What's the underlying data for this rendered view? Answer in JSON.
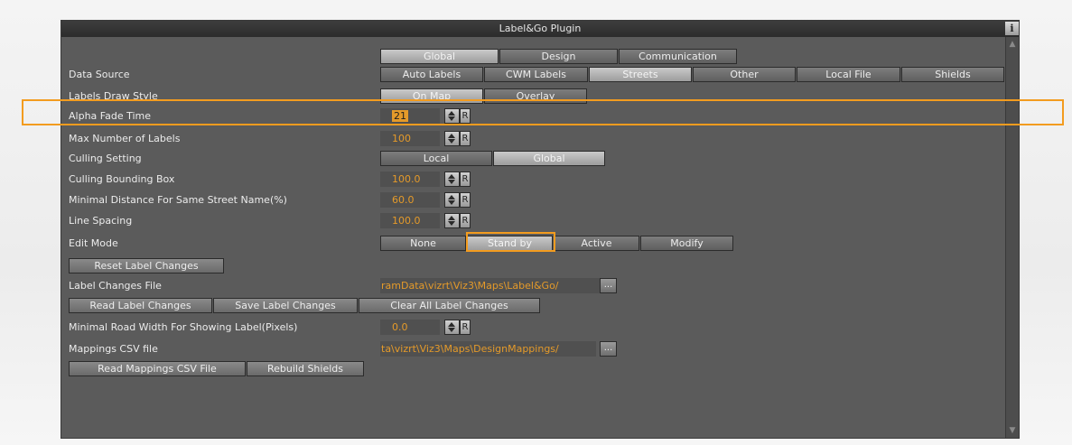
{
  "window": {
    "title": "Label&Go Plugin",
    "info_label": "i"
  },
  "scrollbar": {
    "up_arrow": "▲",
    "down_arrow": "▼"
  },
  "top_tabs": [
    "Global",
    "Design",
    "Communication"
  ],
  "data_source": {
    "label": "Data Source",
    "options": [
      "Auto Labels",
      "CWM Labels",
      "Streets",
      "Other",
      "Local File",
      "Shields"
    ],
    "selected": "Streets"
  },
  "labels_draw_style": {
    "label": "Labels Draw Style",
    "options": [
      "On Map",
      "Overlay"
    ],
    "selected": "On Map"
  },
  "alpha_fade_time": {
    "label": "Alpha Fade Time",
    "value": "21"
  },
  "max_number_of_labels": {
    "label": "Max Number of Labels",
    "value": "100"
  },
  "culling_setting": {
    "label": "Culling Setting",
    "options": [
      "Local",
      "Global"
    ],
    "selected": "Global"
  },
  "culling_bounding_box": {
    "label": "Culling Bounding Box",
    "value": "100.0"
  },
  "minimal_distance": {
    "label": "Minimal Distance For Same Street Name(%)",
    "value": "60.0"
  },
  "line_spacing": {
    "label": "Line Spacing",
    "value": "100.0"
  },
  "edit_mode": {
    "label": "Edit Mode",
    "options": [
      "None",
      "Stand by",
      "Active",
      "Modify"
    ],
    "selected": "Stand by"
  },
  "reset_label_changes": "Reset Label Changes",
  "label_changes_file": {
    "label": "Label Changes File",
    "value": "ramData\\vizrt\\Viz3\\Maps\\Label&Go/"
  },
  "label_change_buttons": [
    "Read Label Changes",
    "Save Label Changes",
    "Clear All Label Changes"
  ],
  "minimal_road_width": {
    "label": "Minimal Road Width For Showing Label(Pixels)",
    "value": "0.0"
  },
  "mappings_csv_file": {
    "label": "Mappings CSV file",
    "value": "ta\\vizrt\\Viz3\\Maps\\DesignMappings/"
  },
  "mapping_buttons": [
    "Read Mappings CSV File",
    "Rebuild Shields"
  ],
  "browse_label": "...",
  "reset_glyph": "R"
}
